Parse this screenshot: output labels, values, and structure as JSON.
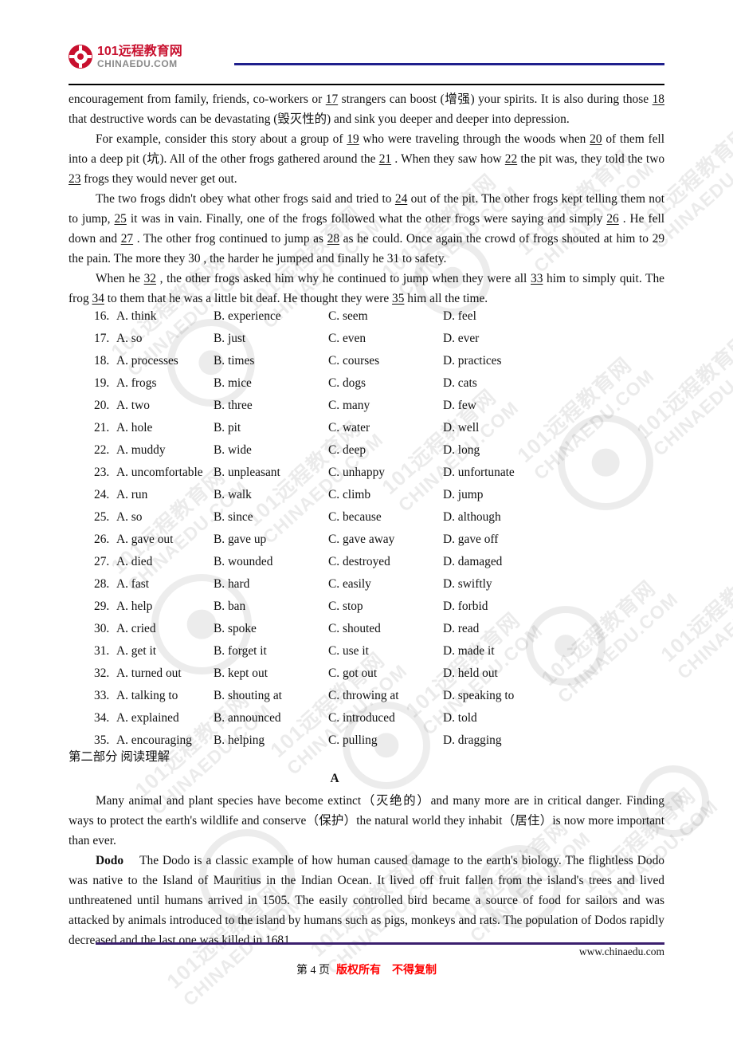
{
  "header": {
    "logo_cn": "101远程教育网",
    "logo_en": "CHINAEDU.COM",
    "logo_icon": "chinaedu-circular-logo"
  },
  "cloze_passage": {
    "para1_line1": "encouragement from family, friends, co-workers or ",
    "blank17": "17",
    "para1_rest1": " strangers can boost (增强) your spirits. It is also during those ",
    "blank18": "18",
    "para1_rest2": " that destructive words can be devastating (毁灭性的) and sink you deeper and deeper into depression.",
    "para2_a": "For example, consider this story about a group of ",
    "blank19": "19",
    "para2_b": " who were traveling through the woods when ",
    "blank20": "20",
    "para2_c": " of them fell into a deep pit (坑). All of the other frogs gathered around the ",
    "blank21": "21",
    "para2_d": " . When they saw how ",
    "blank22": "22",
    "para2_e": " the pit was, they told the two ",
    "blank23": "23",
    "para2_f": " frogs they would never get out.",
    "para3_a": "The two frogs didn't obey what other frogs said and tried to ",
    "blank24": "24",
    "para3_b": " out of the pit. The other frogs kept telling them not to jump, ",
    "blank25": "25",
    "para3_c": " it was in vain. Finally, one of the frogs followed what the other frogs were saying and simply ",
    "blank26": "26",
    "para3_d": " . He fell down and ",
    "blank27": "27",
    "para3_e": " . The other frog continued to jump as ",
    "blank28": "28",
    "para3_f": " as he could. Once again the crowd of frogs shouted at him to ",
    "blank29": "29",
    "para3_g": " the pain. The more they ",
    "blank30": "30",
    "para3_h": " , the harder he jumped and finally he ",
    "blank31": "31",
    "para3_i": " to safety.",
    "para4_a": "When he ",
    "blank32": "32",
    "para4_b": " , the other frogs asked him why he continued to jump when they were all ",
    "blank33": "33",
    "para4_c": " him to simply quit. The frog ",
    "blank34": "34",
    "para4_d": " to them that he was a little bit deaf. He thought they were ",
    "blank35": "35",
    "para4_e": " him all the time."
  },
  "options": [
    {
      "num": "16.",
      "a": "A. think",
      "b": "B. experience",
      "c": "C. seem",
      "d": "D. feel"
    },
    {
      "num": "17.",
      "a": "A. so",
      "b": "B. just",
      "c": "C. even",
      "d": "D. ever"
    },
    {
      "num": "18.",
      "a": "A. processes",
      "b": "B. times",
      "c": "C. courses",
      "d": "D. practices"
    },
    {
      "num": "19.",
      "a": "A. frogs",
      "b": "B. mice",
      "c": "C. dogs",
      "d": "D. cats"
    },
    {
      "num": "20.",
      "a": "A. two",
      "b": "B. three",
      "c": "C. many",
      "d": "D. few"
    },
    {
      "num": "21.",
      "a": "A. hole",
      "b": "B. pit",
      "c": "C. water",
      "d": "D. well"
    },
    {
      "num": "22.",
      "a": "A. muddy",
      "b": "B. wide",
      "c": "C. deep",
      "d": "D. long"
    },
    {
      "num": "23.",
      "a": "A. uncomfortable",
      "b": "B. unpleasant",
      "c": "C. unhappy",
      "d": "D. unfortunate"
    },
    {
      "num": "24.",
      "a": "A. run",
      "b": "B. walk",
      "c": "C. climb",
      "d": "D. jump"
    },
    {
      "num": "25.",
      "a": "A. so",
      "b": "B. since",
      "c": "C. because",
      "d": "D. although"
    },
    {
      "num": "26.",
      "a": "A. gave out",
      "b": "B. gave up",
      "c": "C. gave away",
      "d": "D. gave off"
    },
    {
      "num": "27.",
      "a": "A. died",
      "b": "B. wounded",
      "c": "C. destroyed",
      "d": "D. damaged"
    },
    {
      "num": "28.",
      "a": "A. fast",
      "b": "B. hard",
      "c": "C. easily",
      "d": "D. swiftly"
    },
    {
      "num": "29.",
      "a": "A. help",
      "b": "B. ban",
      "c": "C. stop",
      "d": "D. forbid"
    },
    {
      "num": "30.",
      "a": "A. cried",
      "b": "B. spoke",
      "c": "C. shouted",
      "d": "D. read"
    },
    {
      "num": "31.",
      "a": "A. get it",
      "b": "B. forget it",
      "c": "C. use it",
      "d": "D. made it"
    },
    {
      "num": "32.",
      "a": "A. turned out",
      "b": "B. kept out",
      "c": "C. got out",
      "d": "D. held out"
    },
    {
      "num": "33.",
      "a": "A. talking to",
      "b": "B. shouting at",
      "c": "C. throwing at",
      "d": "D. speaking to"
    },
    {
      "num": "34.",
      "a": "A. explained",
      "b": "B. announced",
      "c": "C. introduced",
      "d": "D. told"
    },
    {
      "num": "35.",
      "a": "A. encouraging",
      "b": "B. helping",
      "c": "C. pulling",
      "d": "D. dragging"
    }
  ],
  "section2": {
    "title": "第二部分 阅读理解",
    "passage_letter": "A",
    "intro": "Many animal and plant species have become extinct（灭绝的）and many more are in critical danger. Finding ways to protect the earth's wildlife and conserve（保护）the natural world they inhabit（居住）is now more important than ever.",
    "dodo_label": "Dodo",
    "dodo_text": "The Dodo is a classic example of how human caused damage to the earth's biology. The flightless Dodo was native to the Island of Mauritius in the Indian Ocean. It lived off fruit fallen from the island's trees and lived unthreatened until humans arrived in 1505. The easily controlled bird became a source of food for sailors and was attacked by animals introduced to the island by humans such as pigs, monkeys and rats. The population of Dodos rapidly decreased and the last one was killed in 1681."
  },
  "footer": {
    "url": "www.chinaedu.com",
    "page": "第 4 页",
    "copyright1": "版权所有",
    "copyright2": "不得复制"
  },
  "colors": {
    "logo_red": "#c8102e",
    "header_rule_blue": "#1f1f8c",
    "footer_rule_purple": "#3b1f6e",
    "footer_red": "#ff0000"
  },
  "watermark": {
    "cn": "101远程教育网",
    "en": "CHINAEDU.COM"
  }
}
